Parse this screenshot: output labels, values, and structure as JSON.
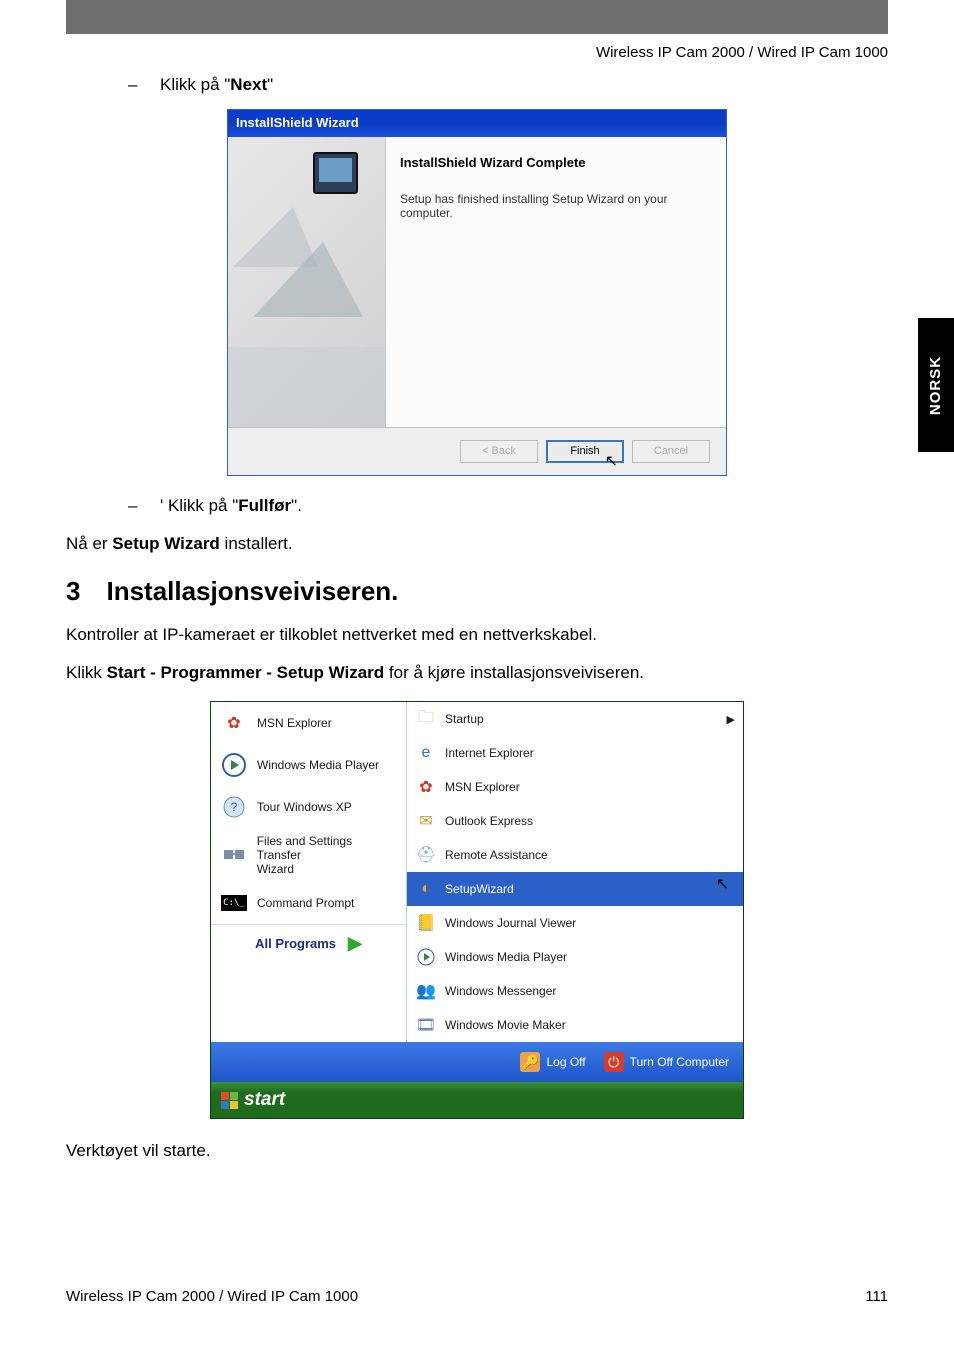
{
  "header": {
    "product_line": "Wireless IP Cam 2000 / Wired IP Cam 1000"
  },
  "side_tab": "NORSK",
  "bullets": {
    "next_prefix": "Klikk på \"",
    "next_bold": "Next",
    "next_suffix": "\"",
    "fullfor_prefix": "' Klikk på \"",
    "fullfor_bold": "Fullfør",
    "fullfor_suffix": "\"."
  },
  "wizard": {
    "titlebar": "InstallShield Wizard",
    "complete_title": "InstallShield Wizard Complete",
    "complete_desc": "Setup has finished installing Setup Wizard on your computer.",
    "btn_back": "< Back",
    "btn_finish": "Finish",
    "btn_cancel": "Cancel"
  },
  "para_installed_prefix": "Nå er ",
  "para_installed_bold": "Setup Wizard",
  "para_installed_suffix": " installert.",
  "section3": {
    "number": "3",
    "title": "Installasjonsveiviseren."
  },
  "para_check": "Kontroller at IP-kameraet er tilkoblet nettverket med en nettverkskabel.",
  "para_run_prefix": "Klikk ",
  "para_run_bold": "Start - Programmer - Setup Wizard",
  "para_run_suffix": " for å kjøre installasjonsveiviseren.",
  "startmenu": {
    "left": {
      "msn_explorer": "MSN Explorer",
      "wmp": "Windows Media Player",
      "tour": "Tour Windows XP",
      "fst_line1": "Files and Settings Transfer",
      "fst_line2": "Wizard",
      "cmd": "Command Prompt",
      "all_programs": "All Programs"
    },
    "right": {
      "startup": "Startup",
      "ie": "Internet Explorer",
      "msn": "MSN Explorer",
      "outlook": "Outlook Express",
      "remote": "Remote Assistance",
      "setupwizard": "SetupWizard",
      "journal": "Windows Journal Viewer",
      "wmp": "Windows Media Player",
      "messenger": "Windows Messenger",
      "moviemaker": "Windows Movie Maker"
    },
    "footer": {
      "logoff": "Log Off",
      "turnoff": "Turn Off Computer"
    },
    "startbtn": "start"
  },
  "para_tool_start": "Verktøyet vil starte.",
  "footer": {
    "left": "Wireless IP Cam 2000 / Wired IP Cam 1000",
    "page_number": "111"
  }
}
